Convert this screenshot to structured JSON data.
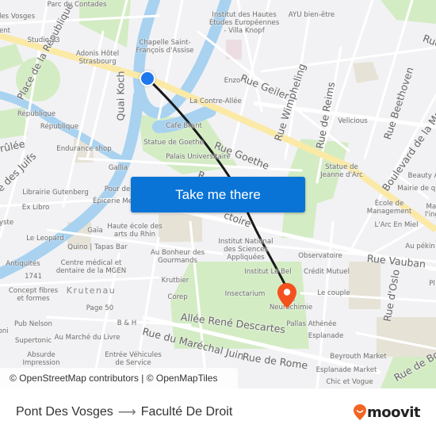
{
  "map": {
    "colors": {
      "background": "#f2f2f4",
      "water": "#a8d2f0",
      "park": "#d4ecc4",
      "major_road": "#fbe9a6",
      "road": "#ffffff",
      "route_line": "#1a1a1a",
      "origin_marker": "#1e77ee",
      "destination_marker": "#f4511e",
      "button": "#0a74d6"
    },
    "streets": [
      {
        "id": "place-republique",
        "label": "Place de la République"
      },
      {
        "id": "quai-koch",
        "label": "Quai Koch"
      },
      {
        "id": "rue-geiler",
        "label": "Rue Geiler"
      },
      {
        "id": "rue-wimpheling",
        "label": "Rue Wimpheling"
      },
      {
        "id": "rue-de-reims",
        "label": "Rue de Reims"
      },
      {
        "id": "rue-beethoven",
        "label": "Rue Beethoven"
      },
      {
        "id": "rue-goethe",
        "label": "Rue Goethe"
      },
      {
        "id": "boulevard-de-la-marne",
        "label": "Boulevard de la Ma"
      },
      {
        "id": "rue-des-juifs",
        "label": "e des Juifs"
      },
      {
        "id": "brulee",
        "label": "rûlée"
      },
      {
        "id": "rue-vauban",
        "label": "Rue Vauban"
      },
      {
        "id": "rue-d-oslo",
        "label": "Rue d'Oslo"
      },
      {
        "id": "allee-rene-descartes",
        "label": "Allée René Descartes"
      },
      {
        "id": "rue-du-marechal-juin",
        "label": "Rue du Maréchal Juin"
      },
      {
        "id": "rue-de-rome",
        "label": "Rue de Rome"
      },
      {
        "id": "rue-de-bos",
        "label": "Rue de Bos"
      },
      {
        "id": "rue-f",
        "label": "Rue"
      },
      {
        "id": "victoire",
        "label": "ctoire"
      },
      {
        "id": "rue-r",
        "label": "R"
      }
    ],
    "district": "Krutenau",
    "places": [
      {
        "label": "Parc du Contades"
      },
      {
        "label": "des Vosges"
      },
      {
        "label": "ent"
      },
      {
        "label": "Studio 23"
      },
      {
        "label": "Adonis Hôtel\nStrasbourg"
      },
      {
        "label": "Chapelle Saint-\nFrançois d'Assise"
      },
      {
        "label": "Institut des Hautes\nÉtudes Européennes\n- Villa Knopf"
      },
      {
        "label": "AYU bien-être"
      },
      {
        "label": "Enzo"
      },
      {
        "label": "La Contre-Allée"
      },
      {
        "label": "République"
      },
      {
        "label": "République"
      },
      {
        "label": "Cafe Brant"
      },
      {
        "label": "Statue de Goethe"
      },
      {
        "label": "Palais Universitaire"
      },
      {
        "label": "Endurance shop"
      },
      {
        "label": "Velicious"
      },
      {
        "label": "Gallia"
      },
      {
        "label": "Statue de\nJeanne d'Arc"
      },
      {
        "label": "Beauty A"
      },
      {
        "label": "Mairie de qu"
      },
      {
        "label": "Librairie Gutenberg"
      },
      {
        "label": "Pour de"
      },
      {
        "label": "Épicerie Me"
      },
      {
        "label": "Ex Libro"
      },
      {
        "label": "École de\nManagement"
      },
      {
        "label": "Mai\nl'ing"
      },
      {
        "label": "L'Arc En Miel"
      },
      {
        "label": "yste"
      },
      {
        "label": "Gaïa"
      },
      {
        "label": "Haute école des\narts du Rhin"
      },
      {
        "label": "Le Leopard"
      },
      {
        "label": "Quino | Tapas Bar"
      },
      {
        "label": "Au pékin"
      },
      {
        "label": "Au Bonheur des\nGourmands"
      },
      {
        "label": "Institut National\ndes Sciences\nAppliquées"
      },
      {
        "label": "Observatoire"
      },
      {
        "label": "Antiquités"
      },
      {
        "label": "Centre médical et\ndentaire de la MGEN"
      },
      {
        "label": "1741"
      },
      {
        "label": "Institut Le Bel"
      },
      {
        "label": "Crédit Mutuel"
      },
      {
        "label": "Krutbier"
      },
      {
        "label": "Concept fibres\net formes"
      },
      {
        "label": "Insectarium"
      },
      {
        "label": "Le couple"
      },
      {
        "label": "Corep"
      },
      {
        "label": "Page 50"
      },
      {
        "label": "de\nNeurochimie"
      },
      {
        "label": "Pl"
      },
      {
        "label": "B & H"
      },
      {
        "label": "Pub Nelson"
      },
      {
        "label": "Pallas Athénée"
      },
      {
        "label": "oni"
      },
      {
        "label": "Supertonic"
      },
      {
        "label": "Au Marché du Livre"
      },
      {
        "label": "Esplanade"
      },
      {
        "label": "Absurde\nImpression"
      },
      {
        "label": "Entrée Véhicules\nde Service"
      },
      {
        "label": "Beyrouth Market"
      },
      {
        "label": "Esplanade Market"
      },
      {
        "label": "Chic et Vogue"
      }
    ],
    "attribution": "© OpenStreetMap contributors | © OpenMapTiles"
  },
  "cta": {
    "label": "Take me there"
  },
  "route": {
    "origin": "Pont Des Vosges",
    "arrow": "⟶",
    "destination": "Faculté De Droit"
  },
  "brand": {
    "name": "moovit",
    "color": "#f26522"
  }
}
